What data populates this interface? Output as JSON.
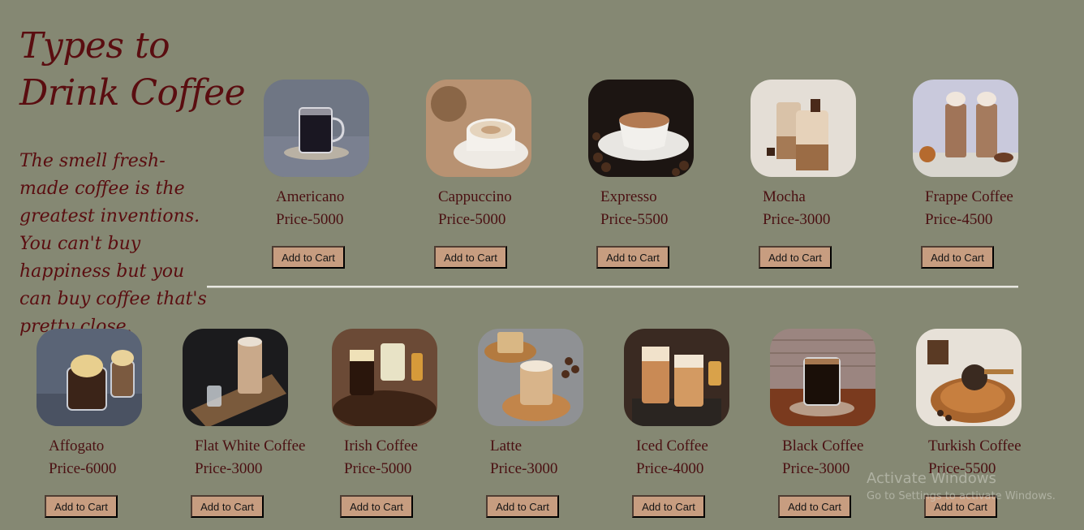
{
  "intro": {
    "title": "Types to Drink Coffee",
    "text": "The smell fresh-made coffee is the greatest inventions. You can't buy happiness but you can buy coffee that's pretty close."
  },
  "colors": {
    "background": "#858873",
    "heading": "#5a0d10",
    "button": "#c79d80"
  },
  "products": [
    {
      "name": "Americano",
      "price": "Price-5000",
      "button": "Add to Cart",
      "image_icon": "americano-image"
    },
    {
      "name": "Cappuccino",
      "price": "Price-5000",
      "button": "Add to Cart",
      "image_icon": "cappuccino-image"
    },
    {
      "name": "Expresso",
      "price": "Price-5500",
      "button": "Add to Cart",
      "image_icon": "espresso-image"
    },
    {
      "name": "Mocha",
      "price": "Price-3000",
      "button": "Add to Cart",
      "image_icon": "mocha-image"
    },
    {
      "name": "Frappe Coffee",
      "price": "Price-4500",
      "button": "Add to Cart",
      "image_icon": "frappe-image"
    },
    {
      "name": "Affogato",
      "price": "Price-6000",
      "button": "Add to Cart",
      "image_icon": "affogato-image"
    },
    {
      "name": "Flat White Coffee",
      "price": "Price-3000",
      "button": "Add to Cart",
      "image_icon": "flat-white-image"
    },
    {
      "name": "Irish Coffee",
      "price": "Price-5000",
      "button": "Add to Cart",
      "image_icon": "irish-coffee-image"
    },
    {
      "name": "Latte",
      "price": "Price-3000",
      "button": "Add to Cart",
      "image_icon": "latte-image"
    },
    {
      "name": "Iced Coffee",
      "price": "Price-4000",
      "button": "Add to Cart",
      "image_icon": "iced-coffee-image"
    },
    {
      "name": "Black Coffee",
      "price": "Price-3000",
      "button": "Add to Cart",
      "image_icon": "black-coffee-image"
    },
    {
      "name": "Turkish Coffee",
      "price": "Price-5500",
      "button": "Add to Cart",
      "image_icon": "turkish-coffee-image"
    }
  ],
  "watermark": {
    "title": "Activate Windows",
    "subtitle": "Go to Settings to activate Windows."
  }
}
